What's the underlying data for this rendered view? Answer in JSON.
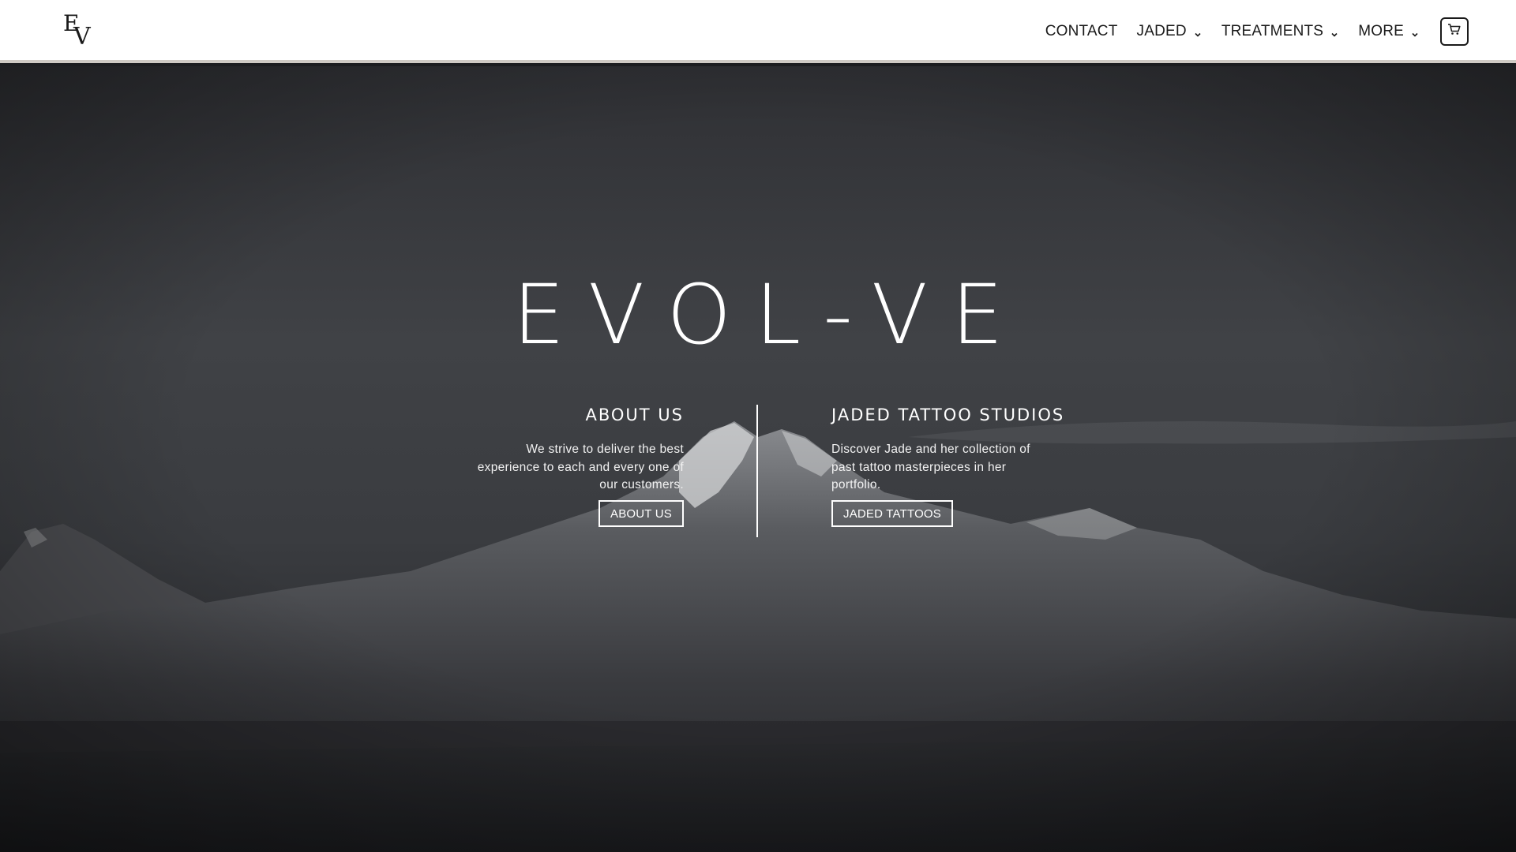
{
  "brand": {
    "logo_letters": [
      "E",
      "V"
    ]
  },
  "nav": {
    "items": [
      {
        "label": "CONTACT",
        "has_dropdown": false
      },
      {
        "label": "JADED",
        "has_dropdown": true
      },
      {
        "label": "TREATMENTS",
        "has_dropdown": true
      },
      {
        "label": "MORE",
        "has_dropdown": true
      }
    ],
    "cart_icon": "cart-icon"
  },
  "hero": {
    "title": "EVOL-VE",
    "about": {
      "heading": "ABOUT US",
      "text": "We strive to deliver the best experience to each and every one of our customers.",
      "button": "ABOUT US"
    },
    "jaded": {
      "heading": "JADED TATTOO STUDIOS",
      "text": "Discover Jade and her collection of past tattoo masterpieces in her portfolio.",
      "button": "JADED TATTOOS"
    }
  },
  "colors": {
    "header_bg": "#ffffff",
    "header_border": "#cfcac4",
    "hero_bg": "#35373b",
    "text_light": "#ffffff",
    "text_dark": "#1a1a1a"
  }
}
